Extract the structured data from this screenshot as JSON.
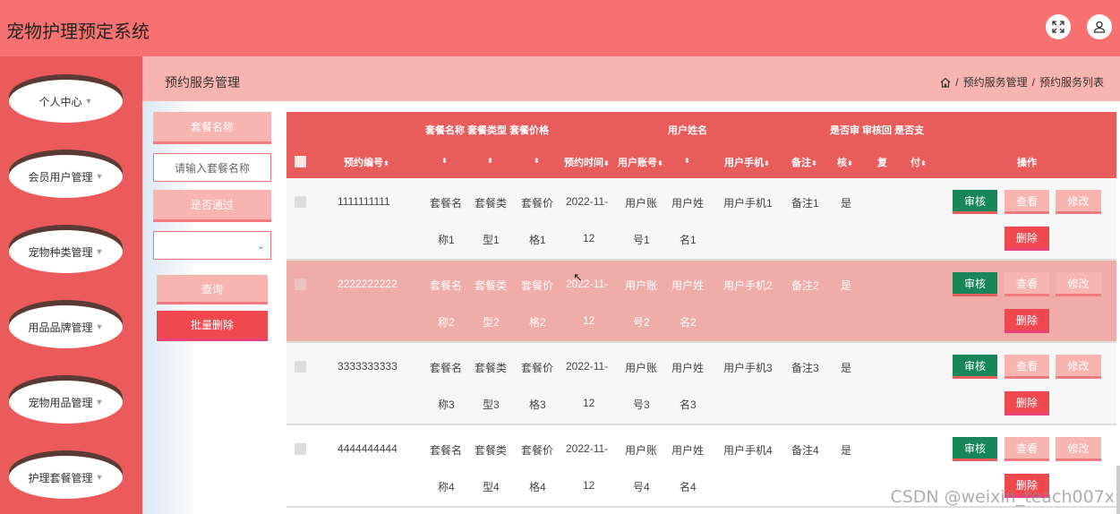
{
  "app": {
    "title": "宠物护理预定系统"
  },
  "topbar": {
    "fullscreen_icon": "expand-icon",
    "user_icon": "user-icon"
  },
  "sidebar": {
    "items": [
      {
        "label": "个人中心"
      },
      {
        "label": "会员用户管理"
      },
      {
        "label": "宠物种类管理"
      },
      {
        "label": "用品品牌管理"
      },
      {
        "label": "宠物用品管理"
      },
      {
        "label": "护理套餐管理"
      }
    ]
  },
  "header": {
    "title": "预约服务管理",
    "breadcrumb": {
      "home_icon": "home-icon",
      "sep": "/",
      "level1": "预约服务管理",
      "level2": "预约服务列表"
    }
  },
  "filters": {
    "package_name_label": "套餐名称",
    "package_name_placeholder": "请输入套餐名称",
    "passed_label": "是否通过",
    "passed_value": "",
    "query_button": "查询",
    "batch_delete_button": "批量删除"
  },
  "table": {
    "header_top": {
      "group1": "套餐名称 套餐类型 套餐价格",
      "group2": "用户姓名",
      "group3": "是否审 审核回 是否支"
    },
    "columns": {
      "booking_no": "预约编号",
      "booking_time": "预约时间",
      "account": "用户账号",
      "phone": "用户手机",
      "remark": "备注",
      "audit_a": "核",
      "audit_b": "复",
      "paid": "付",
      "actions": "操作"
    },
    "sort_glyph": "⬍",
    "rows": [
      {
        "no": "1111111111",
        "name_a": "套餐名",
        "name_b": "称1",
        "type_a": "套餐类",
        "type_b": "型1",
        "price_a": "套餐价",
        "price_b": "格1",
        "time_a": "2022-11-",
        "time_b": "12",
        "acct_a": "用户账",
        "acct_b": "号1",
        "uname_a": "用户姓",
        "uname_b": "名1",
        "phone": "用户手机1",
        "remark": "备注1",
        "audit": "是"
      },
      {
        "no": "2222222222",
        "name_a": "套餐名",
        "name_b": "称2",
        "type_a": "套餐类",
        "type_b": "型2",
        "price_a": "套餐价",
        "price_b": "格2",
        "time_a": "2022-11-",
        "time_b": "12",
        "acct_a": "用户账",
        "acct_b": "号2",
        "uname_a": "用户姓",
        "uname_b": "名2",
        "phone": "用户手机2",
        "remark": "备注2",
        "audit": "是"
      },
      {
        "no": "3333333333",
        "name_a": "套餐名",
        "name_b": "称3",
        "type_a": "套餐类",
        "type_b": "型3",
        "price_a": "套餐价",
        "price_b": "格3",
        "time_a": "2022-11-",
        "time_b": "12",
        "acct_a": "用户账",
        "acct_b": "号3",
        "uname_a": "用户姓",
        "uname_b": "名3",
        "phone": "用户手机3",
        "remark": "备注3",
        "audit": "是"
      },
      {
        "no": "4444444444",
        "name_a": "套餐名",
        "name_b": "称4",
        "type_a": "套餐类",
        "type_b": "型4",
        "price_a": "套餐价",
        "price_b": "格4",
        "time_a": "2022-11-",
        "time_b": "12",
        "acct_a": "用户账",
        "acct_b": "号4",
        "uname_a": "用户姓",
        "uname_b": "名4",
        "phone": "用户手机4",
        "remark": "备注4",
        "audit": "是"
      }
    ],
    "actions": {
      "audit": "审核",
      "view": "查看",
      "edit": "修改",
      "delete": "删除"
    }
  },
  "watermark": "CSDN @weixin_teach007x",
  "colors": {
    "primary": "#e85c5c",
    "topbar": "#f87171",
    "light": "#f8b4b0",
    "danger": "#f0484f",
    "audit": "#17875a"
  }
}
